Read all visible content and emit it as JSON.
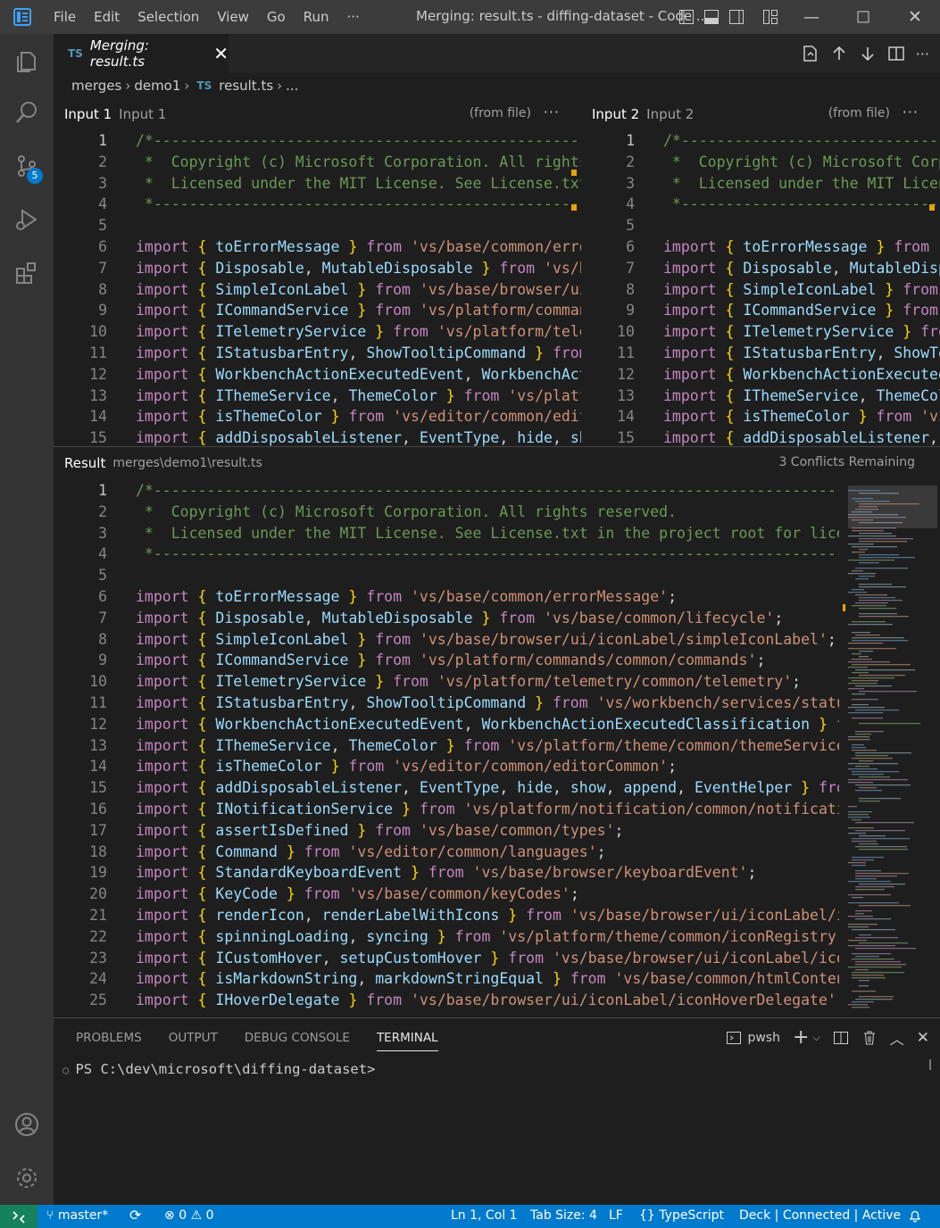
{
  "menu": [
    "File",
    "Edit",
    "Selection",
    "View",
    "Go",
    "Run",
    "···"
  ],
  "window_title": "Merging: result.ts - diffing-dataset - Code ...",
  "activity_badge": "5",
  "tab": {
    "icon": "TS",
    "label": "Merging: result.ts",
    "close": "✕"
  },
  "breadcrumb": {
    "part1": "merges",
    "part2": "demo1",
    "icon": "TS",
    "file": "result.ts",
    "more": "..."
  },
  "input1": {
    "title": "Input 1",
    "subtitle": "Input 1",
    "source": "(from file)",
    "more": "···"
  },
  "input2": {
    "title": "Input 2",
    "subtitle": "Input 2",
    "source": "(from file)",
    "more": "···"
  },
  "result": {
    "title": "Result",
    "path": "merges\\demo1\\result.ts",
    "conflicts": "3 Conflicts Remaining"
  },
  "code_lines": [
    "/*---------------------------------------------------------------------------------------------",
    " *  Copyright (c) Microsoft Corporation. All rights reserved.",
    " *  Licensed under the MIT License. See License.txt in the project root for license information.",
    " *--------------------------------------------------------------------------------------------*/",
    "",
    "import { toErrorMessage } from 'vs/base/common/errorMessage';",
    "import { Disposable, MutableDisposable } from 'vs/base/common/lifecycle';",
    "import { SimpleIconLabel } from 'vs/base/browser/ui/iconLabel/simpleIconLabel';",
    "import { ICommandService } from 'vs/platform/commands/common/commands';",
    "import { ITelemetryService } from 'vs/platform/telemetry/common/telemetry';",
    "import { IStatusbarEntry, ShowTooltipCommand } from 'vs/workbench/services/statusbar/browser/statusbar';",
    "import { WorkbenchActionExecutedEvent, WorkbenchActionExecutedClassification } from 'vs/base/common/actions';",
    "import { IThemeService, ThemeColor } from 'vs/platform/theme/common/themeService';",
    "import { isThemeColor } from 'vs/editor/common/editorCommon';",
    "import { addDisposableListener, EventType, hide, show, append, EventHelper } from 'vs/base/browser/dom';",
    "import { INotificationService } from 'vs/platform/notification/common/notification';",
    "import { assertIsDefined } from 'vs/base/common/types';",
    "import { Command } from 'vs/editor/common/languages';",
    "import { StandardKeyboardEvent } from 'vs/base/browser/keyboardEvent';",
    "import { KeyCode } from 'vs/base/common/keyCodes';",
    "import { renderIcon, renderLabelWithIcons } from 'vs/base/browser/ui/iconLabel/iconLabels';",
    "import { spinningLoading, syncing } from 'vs/platform/theme/common/iconRegistry';",
    "import { ICustomHover, setupCustomHover } from 'vs/base/browser/ui/iconLabel/iconLabelHover';",
    "import { isMarkdownString, markdownStringEqual } from 'vs/base/common/htmlContent';",
    "import { IHoverDelegate } from 'vs/base/browser/ui/iconLabel/iconHoverDelegate';"
  ],
  "panel": {
    "tabs": [
      "PROBLEMS",
      "OUTPUT",
      "DEBUG CONSOLE",
      "TERMINAL"
    ],
    "shell": "pwsh",
    "prompt": "PS C:\\dev\\microsoft\\diffing-dataset>"
  },
  "status": {
    "branch": "master*",
    "errors": "0",
    "warnings": "0",
    "position": "Ln 1, Col 1",
    "tabsize": "Tab Size: 4",
    "eol": "LF",
    "language": "TypeScript",
    "deck": "Deck | Connected | Active"
  },
  "colors": {
    "statusbar": "#007acc",
    "remote": "#16825d",
    "badge": "#007acc",
    "conflict_marker": "#e5a500"
  }
}
